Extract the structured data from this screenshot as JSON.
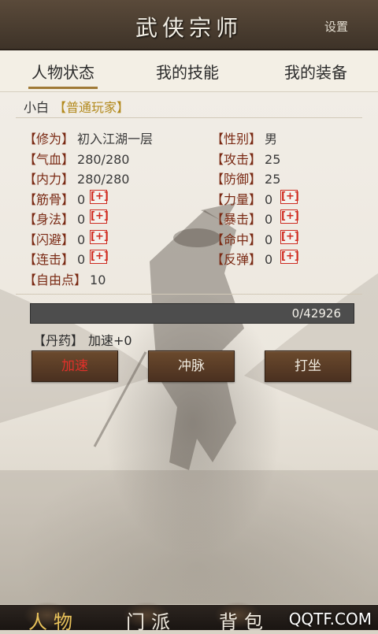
{
  "header": {
    "title": "武侠宗师",
    "settings_label": "设置"
  },
  "tabs": [
    {
      "label": "人物状态",
      "active": true
    },
    {
      "label": "我的技能",
      "active": false
    },
    {
      "label": "我的装备",
      "active": false
    }
  ],
  "player": {
    "name": "小白",
    "rank": "【普通玩家】"
  },
  "stats_left": [
    {
      "label": "【修为】",
      "value": "初入江湖一层",
      "plus": false
    },
    {
      "label": "【气血】",
      "value": "280/280",
      "plus": false
    },
    {
      "label": "【内力】",
      "value": "280/280",
      "plus": false
    },
    {
      "label": "【筋骨】",
      "value": "0",
      "plus": true
    },
    {
      "label": "【身法】",
      "value": "0",
      "plus": true
    },
    {
      "label": "【闪避】",
      "value": "0",
      "plus": true
    },
    {
      "label": "【连击】",
      "value": "0",
      "plus": true
    },
    {
      "label": "【自由点】",
      "value": "10",
      "plus": false
    }
  ],
  "stats_right": [
    {
      "label": "【性别】",
      "value": "男",
      "plus": false
    },
    {
      "label": "【攻击】",
      "value": "25",
      "plus": false
    },
    {
      "label": "【防御】",
      "value": "25",
      "plus": false
    },
    {
      "label": "【力量】",
      "value": "0",
      "plus": true
    },
    {
      "label": "【暴击】",
      "value": "0",
      "plus": true
    },
    {
      "label": "【命中】",
      "value": "0",
      "plus": true
    },
    {
      "label": "【反弹】",
      "value": "0",
      "plus": true
    }
  ],
  "plus_label": "[+]",
  "progress": {
    "text": "0/42926",
    "fraction": 0
  },
  "pill": {
    "label": "【丹药】",
    "value": "加速+0"
  },
  "buttons": [
    {
      "label": "加速",
      "color": "#e0302a"
    },
    {
      "label": "冲脉",
      "color": "#f0ebe0"
    },
    {
      "label": "打坐",
      "color": "#f0ebe0"
    }
  ],
  "bottom_nav": [
    {
      "label": "人物",
      "active": true
    },
    {
      "label": "门派",
      "active": false
    },
    {
      "label": "背包",
      "active": false
    }
  ],
  "watermark": "QQTF.COM",
  "colors": {
    "accent": "#a07a36",
    "stat_label": "#7a2a14",
    "plus": "#d02a1f",
    "rank": "#b38a1e"
  }
}
